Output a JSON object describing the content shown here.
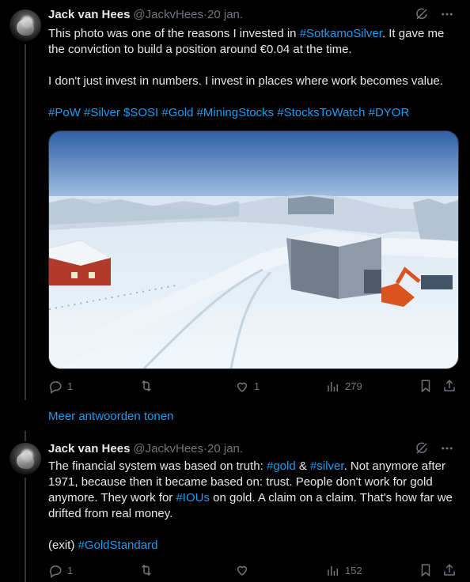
{
  "tweet1": {
    "name": "Jack van Hees",
    "handle": "@JackvHees",
    "sep": " · ",
    "date": "20 jan.",
    "text_a": "This photo was one of the reasons I invested in ",
    "tag_sotkamo": "#SotkamoSilver",
    "text_b": ". It gave me the conviction to build a position around €0.04 at the time.",
    "text_c": "I don't just invest in numbers. I invest in places where work becomes value.",
    "hashtags": "#PoW #Silver $SOSI #Gold #MiningStocks #StocksToWatch #DYOR",
    "replies": "1",
    "reposts": "",
    "likes": "1",
    "views": "279"
  },
  "more_replies": "Meer antwoorden tonen",
  "tweet2": {
    "name": "Jack van Hees",
    "handle": "@JackvHees",
    "sep": " · ",
    "date": "20 jan.",
    "text_a": "The financial system was based on truth: ",
    "tag_gold": "#gold",
    "text_amp": " & ",
    "tag_silver": "#silver",
    "text_b": ". Not anymore after 1971, because then it became based on: trust. People don't work for gold anymore. They work for ",
    "tag_ious": "#IOUs",
    "text_c": " on gold. A claim on a claim. That's how far we drifted from real money.",
    "exit_text": "(exit) ",
    "tag_goldstandard": "#GoldStandard",
    "replies": "1",
    "reposts": "",
    "likes": "",
    "views": "152"
  },
  "colors": {
    "accent": "#1d9bf0",
    "muted": "#71767b",
    "text": "#e7e9ea",
    "bg": "#000000"
  },
  "icons": [
    "grok-icon",
    "more-icon",
    "reply-icon",
    "repost-icon",
    "like-icon",
    "views-icon",
    "bookmark-icon",
    "share-icon"
  ]
}
